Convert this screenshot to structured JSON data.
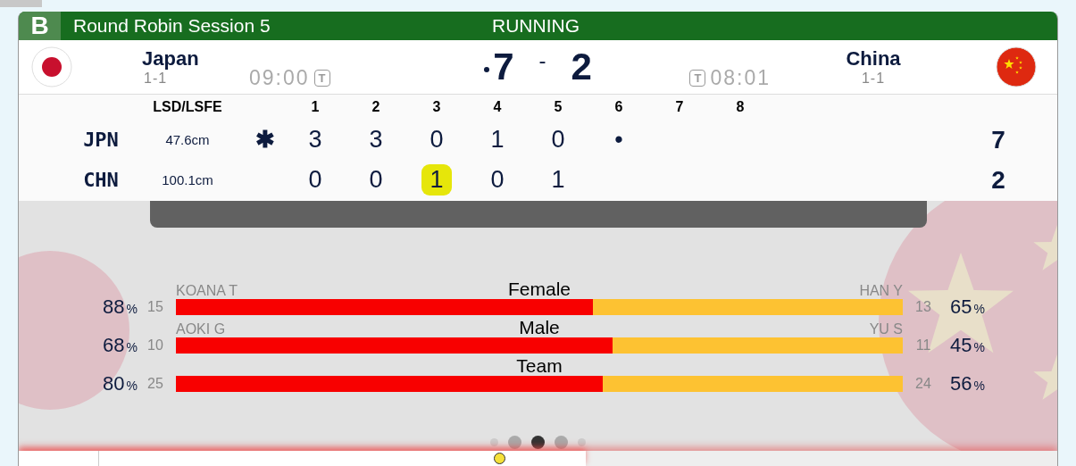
{
  "header": {
    "badge": "B",
    "title": "Round Robin Session 5",
    "status": "RUNNING"
  },
  "teams": [
    {
      "name": "Japan",
      "record": "1-1",
      "time": "09:00",
      "timeout_label": "T",
      "score": "7",
      "hammer": true,
      "kind": "japan"
    },
    {
      "name": "China",
      "record": "1-1",
      "time": "08:01",
      "timeout_label": "T",
      "score": "2",
      "hammer": false,
      "kind": "china"
    }
  ],
  "score_separator": "-",
  "linescore": {
    "lsd_heading": "LSD/LSFE",
    "ends": [
      "1",
      "2",
      "3",
      "4",
      "5",
      "6",
      "7",
      "8"
    ],
    "rows": [
      {
        "team": "JPN",
        "lsd": "47.6cm",
        "mark": "✱",
        "ends": [
          {
            "value": "3",
            "highlighted": false
          },
          {
            "value": "3",
            "highlighted": false
          },
          {
            "value": "0",
            "highlighted": false
          },
          {
            "value": "1",
            "highlighted": false
          },
          {
            "value": "0",
            "highlighted": false
          },
          {
            "value": "•",
            "highlighted": false
          }
        ],
        "total": "7"
      },
      {
        "team": "CHN",
        "lsd": "100.1cm",
        "ends": [
          {
            "value": "0",
            "highlighted": false
          },
          {
            "value": "0",
            "highlighted": false
          },
          {
            "value": "1",
            "highlighted": true
          },
          {
            "value": "0",
            "highlighted": false
          },
          {
            "value": "1",
            "highlighted": false
          }
        ],
        "total": "2"
      }
    ]
  },
  "stats": [
    {
      "category": "Female",
      "level": 0.574,
      "left": {
        "player": "KOANA T",
        "count": "15",
        "percent": "88",
        "unit": "%"
      },
      "right": {
        "player": "HAN Y",
        "count": "13",
        "percent": "65",
        "unit": "%"
      }
    },
    {
      "category": "Male",
      "level": 0.601,
      "left": {
        "player": "AOKI G",
        "count": "10",
        "percent": "68",
        "unit": "%"
      },
      "right": {
        "player": "YU S",
        "count": "11",
        "percent": "45",
        "unit": "%"
      }
    },
    {
      "category": "Team",
      "level": 0.587,
      "left": {
        "count": "25",
        "percent": "80",
        "unit": "%"
      },
      "right": {
        "count": "24",
        "percent": "56",
        "unit": "%"
      }
    }
  ],
  "carousel": [
    {
      "kind": "edge",
      "selected": false
    },
    {
      "kind": "near",
      "selected": false
    },
    {
      "kind": "near",
      "selected": true
    },
    {
      "kind": "near",
      "selected": false
    },
    {
      "kind": "edge",
      "selected": false
    }
  ]
}
